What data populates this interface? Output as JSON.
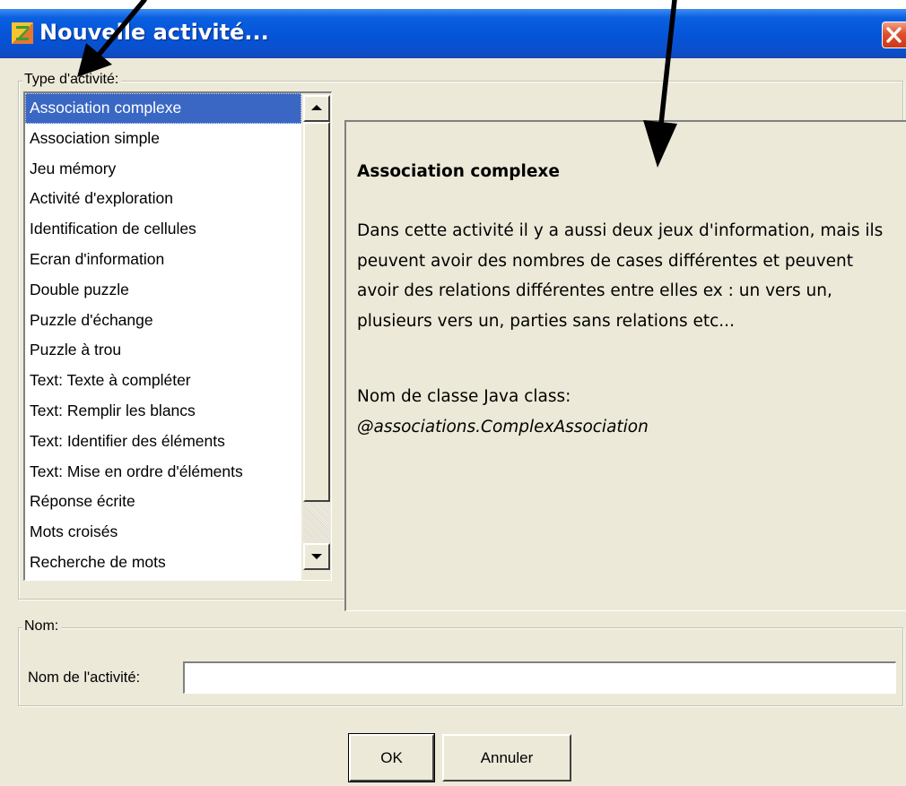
{
  "window": {
    "title": "Nouvelle activité..."
  },
  "type_group": {
    "label": "Type d'activité:",
    "items": [
      {
        "label": "Association complexe",
        "selected": true
      },
      {
        "label": "Association simple",
        "selected": false
      },
      {
        "label": "Jeu mémory",
        "selected": false
      },
      {
        "label": "Activité d'exploration",
        "selected": false
      },
      {
        "label": "Identification de cellules",
        "selected": false
      },
      {
        "label": "Ecran d'information",
        "selected": false
      },
      {
        "label": "Double puzzle",
        "selected": false
      },
      {
        "label": "Puzzle d'échange",
        "selected": false
      },
      {
        "label": "Puzzle à trou",
        "selected": false
      },
      {
        "label": "Text: Texte à compléter",
        "selected": false
      },
      {
        "label": "Text: Remplir les blancs",
        "selected": false
      },
      {
        "label": "Text: Identifier des éléments",
        "selected": false
      },
      {
        "label": "Text: Mise en ordre d'éléments",
        "selected": false
      },
      {
        "label": "Réponse écrite",
        "selected": false
      },
      {
        "label": "Mots croisés",
        "selected": false
      },
      {
        "label": "Recherche de mots",
        "selected": false
      }
    ]
  },
  "description": {
    "title": "Association complexe",
    "body": "Dans cette activité il y a aussi deux jeux d'information, mais ils peuvent avoir des nombres de cases différentes et peuvent avoir des relations différentes entre elles ex : un vers un, plusieurs vers un, parties sans relations etc...",
    "java_label": "Nom de classe Java class:",
    "java_class": "@associations.ComplexAssociation"
  },
  "nom_group": {
    "label": "Nom:",
    "field_label": "Nom de l'activité:",
    "field_value": ""
  },
  "buttons": {
    "ok": "OK",
    "cancel": "Annuler"
  },
  "colors": {
    "titlebar": "#0554d8",
    "dialog_background": "#ece9d8",
    "selection": "#3a67c4",
    "close_button": "#e0502c"
  }
}
